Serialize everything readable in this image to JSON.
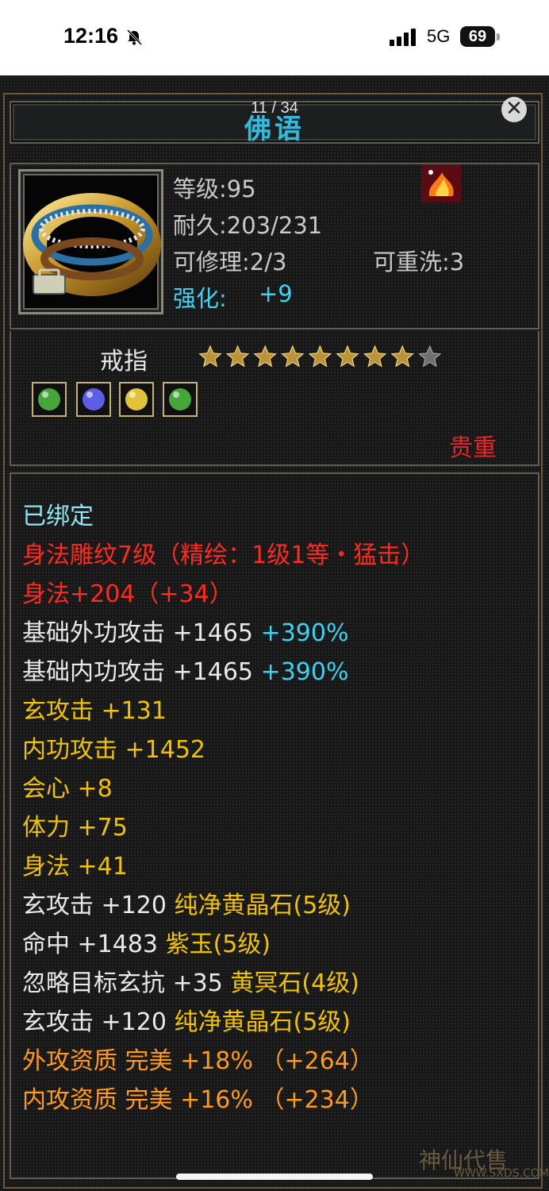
{
  "status_bar": {
    "time": "12:16",
    "network": "5G",
    "battery": "69"
  },
  "viewer": {
    "page_counter": "11 / 34",
    "close_symbol": "✕"
  },
  "item": {
    "name": "佛语",
    "level": "等级:95",
    "durability": "耐久:203/231",
    "repairable": "可修理:2/3",
    "rewashable": "可重洗:3",
    "enhance_label": "强化:",
    "enhance_value": "+9",
    "type": "戒指",
    "stars_filled": 8,
    "stars_total": 9,
    "rarity": "贵重",
    "gem_colors": [
      "#46a63a",
      "#5d5ee6",
      "#e0c33a",
      "#46a63a"
    ]
  },
  "stats": {
    "bound": "已绑定",
    "carve": "身法雕纹7级（精绘：1级1等・猛击）",
    "agility_bonus": "身法+204（+34）",
    "ext_attack_base": "基础外功攻击 +1465",
    "ext_attack_pct": "+390%",
    "int_attack_base": "基础内功攻击 +1465",
    "int_attack_pct": "+390%",
    "mystic_attack": "玄攻击 +131",
    "internal_attack": "内功攻击 +1452",
    "critical": "会心 +8",
    "stamina": "体力 +75",
    "agility": "身法 +41",
    "gem1_stat": "玄攻击 +120",
    "gem1_name": "纯净黄晶石(5级)",
    "gem2_stat": "命中 +1483",
    "gem2_name": "紫玉(5级)",
    "gem3_stat": "忽略目标玄抗 +35",
    "gem3_name": "黄冥石(4级)",
    "gem4_stat": "玄攻击 +120",
    "gem4_name": "纯净黄晶石(5级)",
    "ext_quality": "外攻资质  完美 +18% （+264）",
    "int_quality": "内攻资质  完美 +16% （+234）"
  },
  "watermark": {
    "text": "神仙代售",
    "url": "WWW.SXDS.COM"
  }
}
